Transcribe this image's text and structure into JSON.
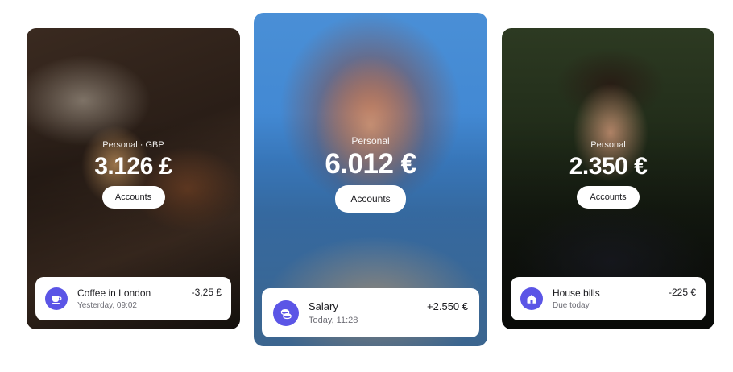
{
  "cards": [
    {
      "subtitle": "Personal · GBP",
      "amount": "3.126 £",
      "button_label": "Accounts",
      "transaction": {
        "title": "Coffee in London",
        "subtitle": "Yesterday, 09:02",
        "amount": "-3,25 £",
        "icon": "coffee-icon"
      }
    },
    {
      "subtitle": "Personal",
      "amount": "6.012 €",
      "button_label": "Accounts",
      "transaction": {
        "title": "Salary",
        "subtitle": "Today, 11:28",
        "amount": "+2.550 €",
        "icon": "coins-icon"
      }
    },
    {
      "subtitle": "Personal",
      "amount": "2.350 €",
      "button_label": "Accounts",
      "transaction": {
        "title": "House bills",
        "subtitle": "Due today",
        "amount": "-225 €",
        "icon": "home-icon"
      }
    }
  ],
  "colors": {
    "accent": "#5b55e6",
    "card_bg": "#ffffff",
    "text_dark": "#1b1b1f",
    "text_muted": "#6e6e76"
  }
}
